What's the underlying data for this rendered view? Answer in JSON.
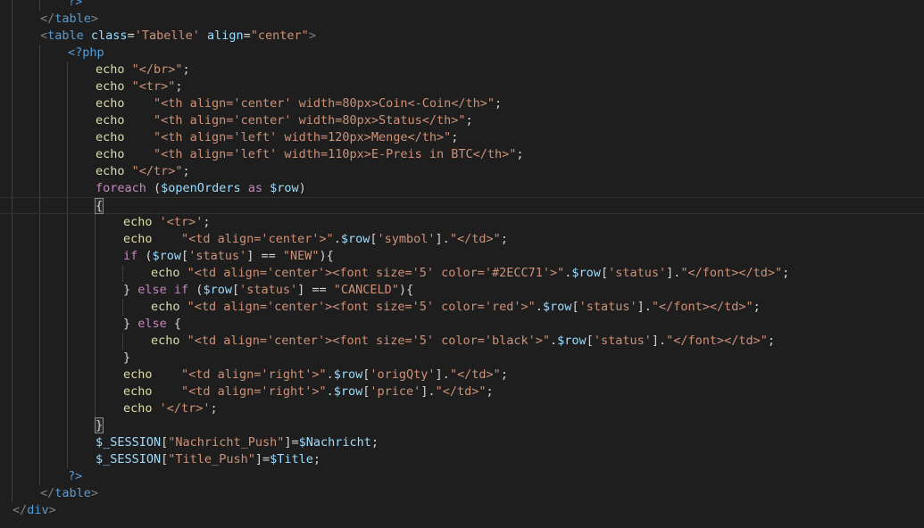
{
  "editor": {
    "lines": [
      {
        "indent": 2,
        "tokens": [
          {
            "t": "?>",
            "c": "php"
          }
        ]
      },
      {
        "indent": 1,
        "tokens": [
          {
            "t": "</",
            "c": "bracket"
          },
          {
            "t": "table",
            "c": "tag"
          },
          {
            "t": ">",
            "c": "bracket"
          }
        ]
      },
      {
        "indent": 1,
        "tokens": [
          {
            "t": "<",
            "c": "bracket"
          },
          {
            "t": "table",
            "c": "tag"
          },
          {
            "t": " ",
            "c": "text"
          },
          {
            "t": "class",
            "c": "attr"
          },
          {
            "t": "=",
            "c": "text"
          },
          {
            "t": "'Tabelle'",
            "c": "string"
          },
          {
            "t": " ",
            "c": "text"
          },
          {
            "t": "align",
            "c": "attr"
          },
          {
            "t": "=",
            "c": "text"
          },
          {
            "t": "\"center\"",
            "c": "string"
          },
          {
            "t": ">",
            "c": "bracket"
          }
        ]
      },
      {
        "indent": 2,
        "tokens": [
          {
            "t": "<?php",
            "c": "php"
          }
        ]
      },
      {
        "indent": 3,
        "tokens": [
          {
            "t": "echo ",
            "c": "func"
          },
          {
            "t": "\"</br>\"",
            "c": "string"
          },
          {
            "t": ";",
            "c": "punct"
          }
        ]
      },
      {
        "indent": 3,
        "tokens": [
          {
            "t": "echo ",
            "c": "func"
          },
          {
            "t": "\"<tr>\"",
            "c": "string"
          },
          {
            "t": ";",
            "c": "punct"
          }
        ]
      },
      {
        "indent": 3,
        "tokens": [
          {
            "t": "echo    ",
            "c": "func"
          },
          {
            "t": "\"<th align='center' width=80px>Coin<-Coin</th>\"",
            "c": "string"
          },
          {
            "t": ";",
            "c": "punct"
          }
        ]
      },
      {
        "indent": 3,
        "tokens": [
          {
            "t": "echo    ",
            "c": "func"
          },
          {
            "t": "\"<th align='center' width=80px>Status</th>\"",
            "c": "string"
          },
          {
            "t": ";",
            "c": "punct"
          }
        ]
      },
      {
        "indent": 3,
        "tokens": [
          {
            "t": "echo    ",
            "c": "func"
          },
          {
            "t": "\"<th align='left' width=120px>Menge</th>\"",
            "c": "string"
          },
          {
            "t": ";",
            "c": "punct"
          }
        ]
      },
      {
        "indent": 3,
        "tokens": [
          {
            "t": "echo    ",
            "c": "func"
          },
          {
            "t": "\"<th align='left' width=110px>E-Preis in BTC</th>\"",
            "c": "string"
          },
          {
            "t": ";",
            "c": "punct"
          }
        ]
      },
      {
        "indent": 3,
        "tokens": [
          {
            "t": "echo ",
            "c": "func"
          },
          {
            "t": "\"</tr>\"",
            "c": "string"
          },
          {
            "t": ";",
            "c": "punct"
          }
        ]
      },
      {
        "indent": 3,
        "tokens": [
          {
            "t": "foreach",
            "c": "keyword"
          },
          {
            "t": " (",
            "c": "punct"
          },
          {
            "t": "$openOrders",
            "c": "var"
          },
          {
            "t": " as ",
            "c": "keyword"
          },
          {
            "t": "$row",
            "c": "var"
          },
          {
            "t": ")",
            "c": "punct"
          }
        ]
      },
      {
        "indent": 3,
        "current": true,
        "tokens": [
          {
            "t": "{",
            "c": "match"
          }
        ]
      },
      {
        "indent": 4,
        "tokens": [
          {
            "t": "echo ",
            "c": "func"
          },
          {
            "t": "'<tr>'",
            "c": "string"
          },
          {
            "t": ";",
            "c": "punct"
          }
        ]
      },
      {
        "indent": 4,
        "tokens": [
          {
            "t": "echo    ",
            "c": "func"
          },
          {
            "t": "\"<td align='center'>\"",
            "c": "string"
          },
          {
            "t": ".",
            "c": "punct"
          },
          {
            "t": "$row",
            "c": "var"
          },
          {
            "t": "[",
            "c": "punct"
          },
          {
            "t": "'symbol'",
            "c": "string"
          },
          {
            "t": "].",
            "c": "punct"
          },
          {
            "t": "\"</td>\"",
            "c": "string"
          },
          {
            "t": ";",
            "c": "punct"
          }
        ]
      },
      {
        "indent": 4,
        "tokens": [
          {
            "t": "if",
            "c": "keyword"
          },
          {
            "t": " (",
            "c": "punct"
          },
          {
            "t": "$row",
            "c": "var"
          },
          {
            "t": "[",
            "c": "punct"
          },
          {
            "t": "'status'",
            "c": "string"
          },
          {
            "t": "] == ",
            "c": "punct"
          },
          {
            "t": "\"NEW\"",
            "c": "string"
          },
          {
            "t": "){",
            "c": "punct"
          }
        ]
      },
      {
        "indent": 5,
        "tokens": [
          {
            "t": "echo ",
            "c": "func"
          },
          {
            "t": "\"<td align='center'><font size='5' color='#2ECC71'>\"",
            "c": "string"
          },
          {
            "t": ".",
            "c": "punct"
          },
          {
            "t": "$row",
            "c": "var"
          },
          {
            "t": "[",
            "c": "punct"
          },
          {
            "t": "'status'",
            "c": "string"
          },
          {
            "t": "].",
            "c": "punct"
          },
          {
            "t": "\"</font></td>\"",
            "c": "string"
          },
          {
            "t": ";",
            "c": "punct"
          }
        ]
      },
      {
        "indent": 4,
        "tokens": [
          {
            "t": "} ",
            "c": "punct"
          },
          {
            "t": "else if",
            "c": "keyword"
          },
          {
            "t": " (",
            "c": "punct"
          },
          {
            "t": "$row",
            "c": "var"
          },
          {
            "t": "[",
            "c": "punct"
          },
          {
            "t": "'status'",
            "c": "string"
          },
          {
            "t": "] == ",
            "c": "punct"
          },
          {
            "t": "\"CANCELD\"",
            "c": "string"
          },
          {
            "t": "){",
            "c": "punct"
          }
        ]
      },
      {
        "indent": 5,
        "tokens": [
          {
            "t": "echo ",
            "c": "func"
          },
          {
            "t": "\"<td align='center'><font size='5' color='red'>\"",
            "c": "string"
          },
          {
            "t": ".",
            "c": "punct"
          },
          {
            "t": "$row",
            "c": "var"
          },
          {
            "t": "[",
            "c": "punct"
          },
          {
            "t": "'status'",
            "c": "string"
          },
          {
            "t": "].",
            "c": "punct"
          },
          {
            "t": "\"</font></td>\"",
            "c": "string"
          },
          {
            "t": ";",
            "c": "punct"
          }
        ]
      },
      {
        "indent": 4,
        "tokens": [
          {
            "t": "} ",
            "c": "punct"
          },
          {
            "t": "else",
            "c": "keyword"
          },
          {
            "t": " {",
            "c": "punct"
          }
        ]
      },
      {
        "indent": 5,
        "tokens": [
          {
            "t": "echo ",
            "c": "func"
          },
          {
            "t": "\"<td align='center'><font size='5' color='black'>\"",
            "c": "string"
          },
          {
            "t": ".",
            "c": "punct"
          },
          {
            "t": "$row",
            "c": "var"
          },
          {
            "t": "[",
            "c": "punct"
          },
          {
            "t": "'status'",
            "c": "string"
          },
          {
            "t": "].",
            "c": "punct"
          },
          {
            "t": "\"</font></td>\"",
            "c": "string"
          },
          {
            "t": ";",
            "c": "punct"
          }
        ]
      },
      {
        "indent": 4,
        "tokens": [
          {
            "t": "}",
            "c": "punct"
          }
        ]
      },
      {
        "indent": 4,
        "tokens": [
          {
            "t": "echo    ",
            "c": "func"
          },
          {
            "t": "\"<td align='right'>\"",
            "c": "string"
          },
          {
            "t": ".",
            "c": "punct"
          },
          {
            "t": "$row",
            "c": "var"
          },
          {
            "t": "[",
            "c": "punct"
          },
          {
            "t": "'origQty'",
            "c": "string"
          },
          {
            "t": "].",
            "c": "punct"
          },
          {
            "t": "\"</td>\"",
            "c": "string"
          },
          {
            "t": ";",
            "c": "punct"
          }
        ]
      },
      {
        "indent": 4,
        "tokens": [
          {
            "t": "echo    ",
            "c": "func"
          },
          {
            "t": "\"<td align='right'>\"",
            "c": "string"
          },
          {
            "t": ".",
            "c": "punct"
          },
          {
            "t": "$row",
            "c": "var"
          },
          {
            "t": "[",
            "c": "punct"
          },
          {
            "t": "'price'",
            "c": "string"
          },
          {
            "t": "].",
            "c": "punct"
          },
          {
            "t": "\"</td>\"",
            "c": "string"
          },
          {
            "t": ";",
            "c": "punct"
          }
        ]
      },
      {
        "indent": 4,
        "tokens": [
          {
            "t": "echo ",
            "c": "func"
          },
          {
            "t": "'</tr>'",
            "c": "string"
          },
          {
            "t": ";",
            "c": "punct"
          }
        ]
      },
      {
        "indent": 3,
        "tokens": [
          {
            "t": "}",
            "c": "match"
          }
        ]
      },
      {
        "indent": 3,
        "tokens": [
          {
            "t": "$_SESSION",
            "c": "var"
          },
          {
            "t": "[",
            "c": "punct"
          },
          {
            "t": "\"Nachricht_Push\"",
            "c": "string"
          },
          {
            "t": "]=",
            "c": "punct"
          },
          {
            "t": "$Nachricht",
            "c": "var"
          },
          {
            "t": ";",
            "c": "punct"
          }
        ]
      },
      {
        "indent": 3,
        "tokens": [
          {
            "t": "$_SESSION",
            "c": "var"
          },
          {
            "t": "[",
            "c": "punct"
          },
          {
            "t": "\"Title_Push\"",
            "c": "string"
          },
          {
            "t": "]=",
            "c": "punct"
          },
          {
            "t": "$Title",
            "c": "var"
          },
          {
            "t": ";",
            "c": "punct"
          }
        ]
      },
      {
        "indent": 2,
        "tokens": [
          {
            "t": "?>",
            "c": "php"
          }
        ]
      },
      {
        "indent": 1,
        "tokens": [
          {
            "t": "</",
            "c": "bracket"
          },
          {
            "t": "table",
            "c": "tag"
          },
          {
            "t": ">",
            "c": "bracket"
          }
        ]
      },
      {
        "indent": 0,
        "tokens": [
          {
            "t": "</",
            "c": "bracket"
          },
          {
            "t": "div",
            "c": "tag"
          },
          {
            "t": ">",
            "c": "bracket"
          }
        ]
      }
    ]
  }
}
